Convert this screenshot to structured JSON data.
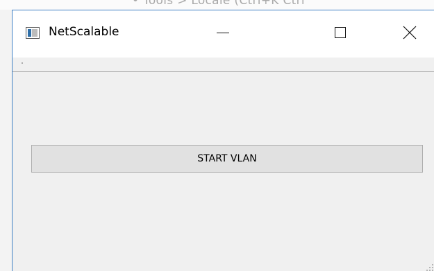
{
  "background_window": {
    "partial_text": "• Tools > Locale (Ctrl+K Ctrl"
  },
  "window": {
    "title": "NetScalable",
    "app_icon": "application-window-icon",
    "controls": {
      "minimize": "minimize-icon",
      "maximize": "maximize-icon",
      "close": "close-icon"
    }
  },
  "main": {
    "start_button_label": "START VLAN"
  },
  "colors": {
    "window_border": "#3d7fc4",
    "titlebar_bg": "#ffffff",
    "client_bg": "#f0f0f0",
    "button_bg": "#e1e1e1",
    "button_border": "#adadad"
  }
}
